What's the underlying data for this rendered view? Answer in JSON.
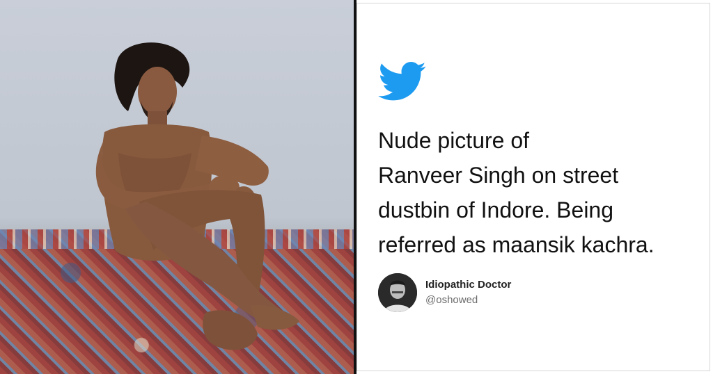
{
  "tweet": {
    "text": "Nude picture of\nRanveer Singh on street\ndustbin of Indore. Being\nreferred as maansik kachra.",
    "author_name": "Idiopathic Doctor",
    "author_handle": "@oshowed",
    "bird_color": "#1d9bf0"
  },
  "icons": {
    "brand": "twitter-bird-icon"
  }
}
